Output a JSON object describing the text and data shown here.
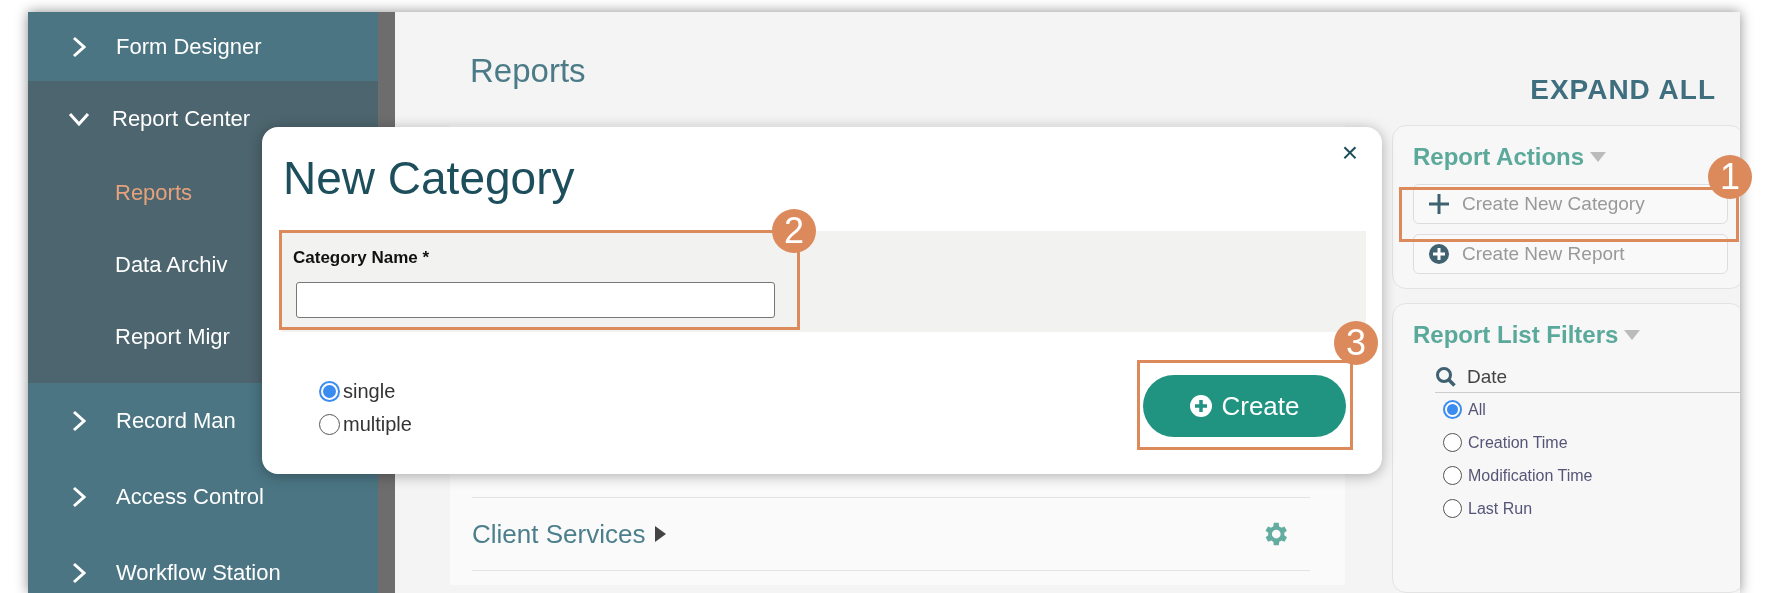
{
  "sidebar": {
    "items": [
      {
        "label": "Form Designer",
        "expanded": false
      },
      {
        "label": "Report Center",
        "expanded": true,
        "children": [
          {
            "label": "Reports",
            "selected": true
          },
          {
            "label": "Data Archiv",
            "selected": false
          },
          {
            "label": "Report Migr",
            "selected": false
          }
        ]
      },
      {
        "label": "Record Man",
        "expanded": false
      },
      {
        "label": "Access Control",
        "expanded": false
      },
      {
        "label": "Workflow Station",
        "expanded": false
      }
    ]
  },
  "main": {
    "title": "Reports",
    "expand_all": "EXPAND ALL",
    "rows": [
      {
        "kind": "category",
        "label": "Client Services"
      }
    ]
  },
  "report_actions": {
    "title": "Report Actions",
    "buttons": [
      {
        "kind": "plus",
        "label": "Create New Category"
      },
      {
        "kind": "plus-circle",
        "label": "Create New Report"
      }
    ]
  },
  "filters": {
    "title": "Report List Filters",
    "groups": [
      {
        "title": "Date",
        "options": [
          {
            "label": "All",
            "selected": true
          },
          {
            "label": "Creation Time",
            "selected": false
          },
          {
            "label": "Modification Time",
            "selected": false
          },
          {
            "label": "Last Run",
            "selected": false
          }
        ]
      }
    ]
  },
  "dialog": {
    "title": "New Category",
    "close": "×",
    "field_label": "Category Name *",
    "radios": [
      {
        "label": "single",
        "selected": true
      },
      {
        "label": "multiple",
        "selected": false
      }
    ],
    "create": "Create"
  },
  "annotations": [
    {
      "number": "1"
    },
    {
      "number": "2"
    },
    {
      "number": "3"
    }
  ]
}
